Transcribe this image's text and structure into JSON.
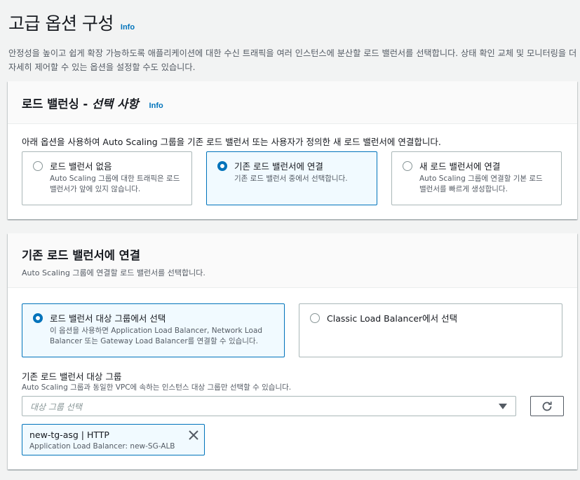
{
  "header": {
    "title": "고급 옵션 구성",
    "info": "Info",
    "description": "안정성을 높이고 쉽게 확장 가능하도록 애플리케이션에 대한 수신 트래픽을 여러 인스턴스에 분산할 로드 밸런서를 선택합니다. 상태 확인 교체 및 모니터링을 더 자세히 제어할 수 있는 옵션을 설정할 수도 있습니다."
  },
  "load_balancing": {
    "title_prefix": "로드 밸런싱 - ",
    "title_optional": "선택 사항",
    "info": "Info",
    "description": "아래 옵션을 사용하여 Auto Scaling 그룹을 기존 로드 밸런서 또는 사용자가 정의한 새 로드 밸런서에 연결합니다.",
    "options": [
      {
        "label": "로드 밸런서 없음",
        "description": "Auto Scaling 그룹에 대한 트래픽은 로드 밸런서가 앞에 있지 않습니다.",
        "selected": false
      },
      {
        "label": "기존 로드 밸런서에 연결",
        "description": "기존 로드 밸런서 중에서 선택합니다.",
        "selected": true
      },
      {
        "label": "새 로드 밸런서에 연결",
        "description": "Auto Scaling 그룹에 연결할 기본 로드 밸런서를 빠르게 생성합니다.",
        "selected": false
      }
    ]
  },
  "attach_existing": {
    "title": "기존 로드 밸런서에 연결",
    "subtitle": "Auto Scaling 그룹에 연결할 로드 밸런서를 선택합니다.",
    "options": [
      {
        "label": "로드 밸런서 대상 그룹에서 선택",
        "description": "이 옵션을 사용하면 Application Load Balancer, Network Load Balancer 또는 Gateway Load Balancer를 연결할 수 있습니다.",
        "selected": true
      },
      {
        "label": "Classic Load Balancer에서 선택",
        "description": "",
        "selected": false
      }
    ],
    "target_group_label": "기존 로드 밸런서 대상 그룹",
    "target_group_desc": "Auto Scaling 그룹과 동일한 VPC에 속하는 인스턴스 대상 그룹만 선택할 수 있습니다.",
    "select_placeholder": "대상 그룹 선택",
    "token": {
      "title": "new-tg-asg | HTTP",
      "subtitle": "Application Load Balancer: new-SG-ALB"
    }
  },
  "colors": {
    "accent": "#0073bb",
    "selected_bg": "#f1faff",
    "border": "#aab7b8"
  },
  "icons": [
    "refresh-icon",
    "close-icon",
    "caret-down-icon"
  ]
}
